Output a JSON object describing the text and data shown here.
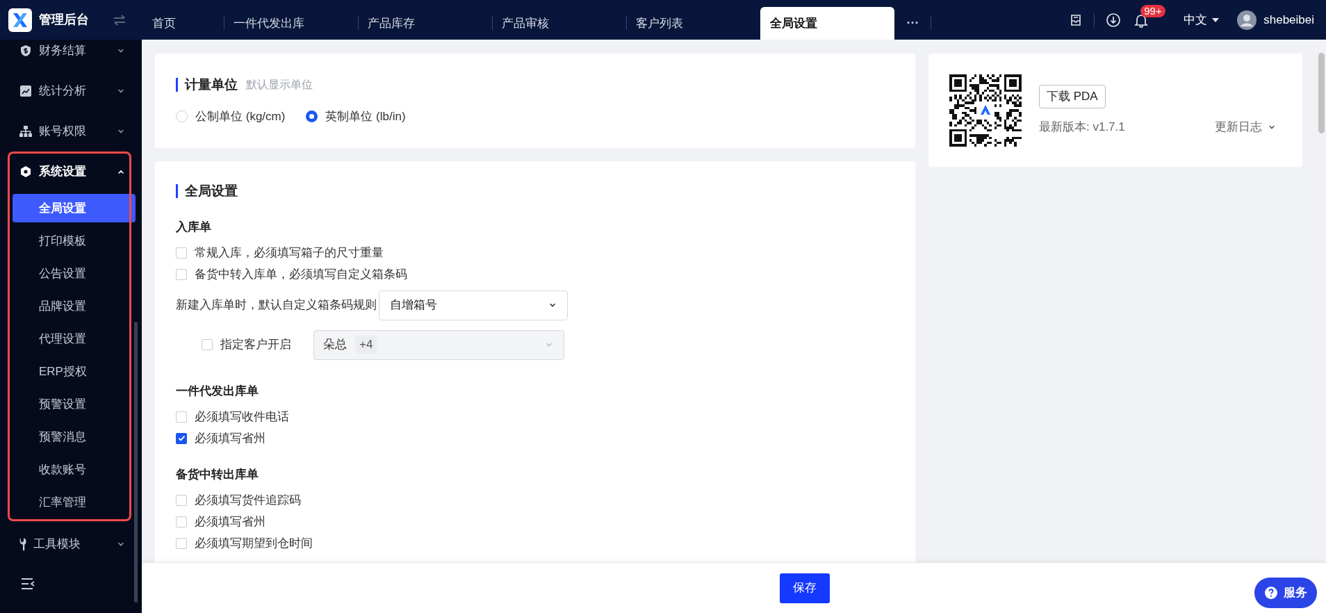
{
  "header": {
    "app_title": "管理后台",
    "tabs": [
      {
        "label": "首页",
        "selected": false
      },
      {
        "label": "一件代发出库",
        "selected": false
      },
      {
        "label": "产品库存",
        "selected": false
      },
      {
        "label": "产品审核",
        "selected": false
      },
      {
        "label": "客户列表",
        "selected": false
      },
      {
        "label": "全局设置",
        "selected": true
      }
    ],
    "more": "···",
    "notification_badge": "99+",
    "language": "中文",
    "username": "shebeibei"
  },
  "sidebar": {
    "items": [
      {
        "label": "财务结算",
        "expanded": false
      },
      {
        "label": "统计分析",
        "expanded": false
      },
      {
        "label": "账号权限",
        "expanded": false
      },
      {
        "label": "系统设置",
        "expanded": true,
        "highlighted": true,
        "children": [
          {
            "label": "全局设置",
            "selected": true
          },
          {
            "label": "打印模板",
            "selected": false
          },
          {
            "label": "公告设置",
            "selected": false
          },
          {
            "label": "品牌设置",
            "selected": false
          },
          {
            "label": "代理设置",
            "selected": false
          },
          {
            "label": "ERP授权",
            "selected": false
          },
          {
            "label": "预警设置",
            "selected": false
          },
          {
            "label": "预警消息",
            "selected": false
          },
          {
            "label": "收款账号",
            "selected": false
          },
          {
            "label": "汇率管理",
            "selected": false
          }
        ]
      },
      {
        "label": "工具模块",
        "expanded": false
      }
    ]
  },
  "units_card": {
    "title": "计量单位",
    "hint": "默认显示单位",
    "options": [
      {
        "label": "公制单位 (kg/cm)",
        "selected": false
      },
      {
        "label": "英制单位 (lb/in)",
        "selected": true
      }
    ]
  },
  "global_card": {
    "title": "全局设置",
    "sections": [
      {
        "heading": "入库单",
        "items": [
          {
            "kind": "checkbox",
            "label": "常规入库，必须填写箱子的尺寸重量",
            "checked": false
          },
          {
            "kind": "checkbox",
            "label": "备货中转入库单，必须填写自定义箱条码",
            "checked": false
          },
          {
            "kind": "select",
            "label": "新建入库单时，默认自定义箱条码规则",
            "value": "自增箱号"
          },
          {
            "kind": "customer_select",
            "label": "指定客户开启",
            "checked": false,
            "tag": "朵总",
            "more": "+4",
            "disabled": true
          }
        ]
      },
      {
        "heading": "一件代发出库单",
        "items": [
          {
            "kind": "checkbox",
            "label": "必须填写收件电话",
            "checked": false
          },
          {
            "kind": "checkbox",
            "label": "必须填写省州",
            "checked": true
          }
        ]
      },
      {
        "heading": "备货中转出库单",
        "items": [
          {
            "kind": "checkbox",
            "label": "必须填写货件追踪码",
            "checked": false
          },
          {
            "kind": "checkbox",
            "label": "必须填写省州",
            "checked": false
          },
          {
            "kind": "checkbox",
            "label": "必须填写期望到仓时间",
            "checked": false
          }
        ]
      }
    ]
  },
  "pda_card": {
    "button": "下载 PDA",
    "version": "最新版本: v1.7.1",
    "changelog": "更新日志"
  },
  "footer": {
    "save_button": "保存",
    "service_button": "服务"
  }
}
